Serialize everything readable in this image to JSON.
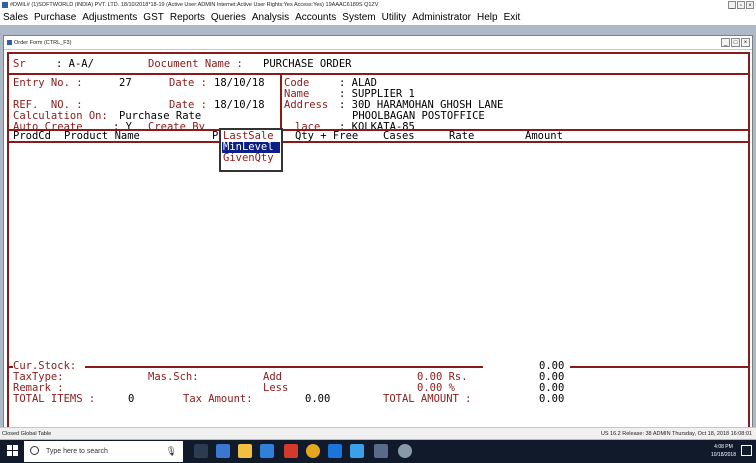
{
  "window": {
    "title": "#DWIL#     (1)SOFTWORLD (INDIA) PVT. LTD.     18/10/2018*18-19     (Active User:ADMIN Internet:Active  User Rights:Yes Access:Yes) 19AAAC6189S Q1ZV",
    "min": "_",
    "max": "▫",
    "close": "×"
  },
  "menu": [
    "Sales",
    "Purchase",
    "Adjustments",
    "GST",
    "Reports",
    "Queries",
    "Analysis",
    "Accounts",
    "System",
    "Utility",
    "Administrator",
    "Help",
    "Exit"
  ],
  "child": {
    "title": "Order Form (CTRL_F3)",
    "min": "_",
    "max": "□",
    "close": "×"
  },
  "form": {
    "sr_label": "Sr",
    "sr_value": ": A-A/",
    "doc_label": "Document Name :",
    "doc_value": "PURCHASE ORDER",
    "entry_label": "Entry No. :",
    "entry_value": "27",
    "date1_label": "Date :",
    "date1_value": "18/10/18",
    "ref_label": "REF.  NO. :",
    "date2_label": "Date :",
    "date2_value": "18/10/18",
    "calc_label": "Calculation On:",
    "calc_value": "Purchase Rate",
    "auto_label": "Auto Create",
    "auto_value": ": Y",
    "create_label": "Create By",
    "code_label": "Code",
    "code_value": ": ALAD",
    "name_label": "Name",
    "name_value": ": SUPPLIER 1",
    "address_label": "Address",
    "address_line1": ": 30D HARAMOHAN GHOSH LANE",
    "address_line2": "PHOOLBAGAN POSTOFFICE",
    "place_label": "lace",
    "place_value": ": KOLKATA-85"
  },
  "columns": {
    "prodcd": "ProdCd",
    "product_name": "Product Name",
    "p": "P",
    "qty_free": "Qty + Free",
    "cases": "Cases",
    "rate": "Rate",
    "amount": "Amount"
  },
  "popup": {
    "items": [
      "LastSale",
      "MinLevel",
      "GivenQty"
    ],
    "selected": 1
  },
  "footer": {
    "cur_stock": "Cur.Stock:",
    "tax_type": "TaxType:",
    "mas_sch": "Mas.Sch:",
    "add": "Add",
    "less": "Less",
    "remark": "Remark :",
    "total_items_label": "TOTAL ITEMS :",
    "total_items_value": "0",
    "tax_amount_label": "Tax Amount:",
    "tax_amount_value": "0.00",
    "total_amount_label": "TOTAL AMOUNT :",
    "add_value": "0.00 Rs.",
    "less_value": "0.00 %",
    "r1": "0.00",
    "r2": "0.00",
    "r3": "0.00",
    "r4": "0.00"
  },
  "status": {
    "left": "Closed Global Table",
    "right": "US 16.2 Release: 38 ADMIN Thursday, Oct 18, 2018 16:08:01"
  },
  "taskbar": {
    "search_placeholder": "Type here to search",
    "time": "4:08 PM",
    "date": "10/18/2018"
  },
  "colors": {
    "form_red": "#8b1a1a",
    "selection_blue": "#0b1f86",
    "mdi_bg": "#aeb9c7",
    "taskbar": "#101a2b"
  }
}
